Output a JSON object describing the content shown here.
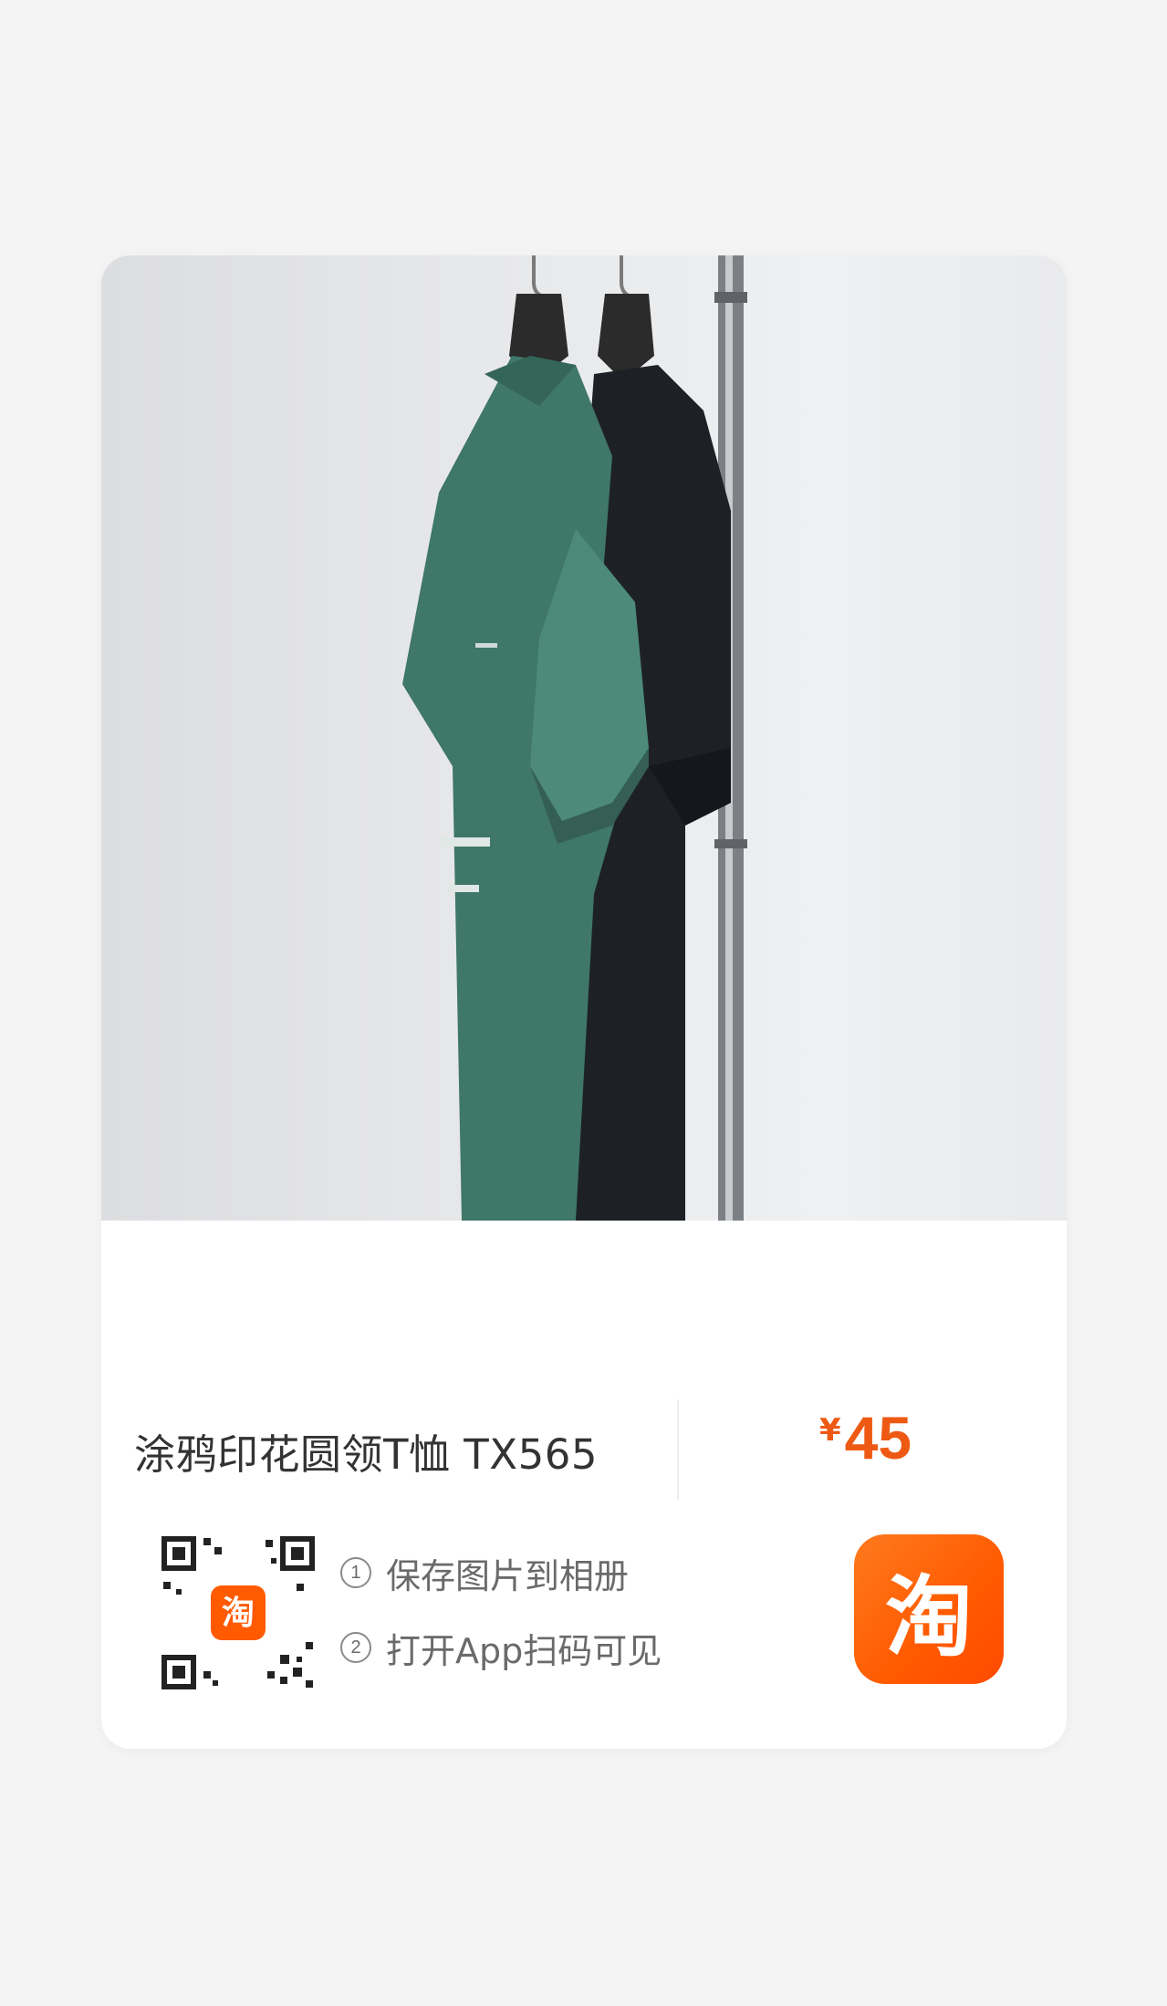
{
  "product": {
    "title": "涂鸦印花圆领T恤 TX565",
    "currency": "¥",
    "price": "45"
  },
  "qr_badge": "淘",
  "steps": [
    {
      "num": "1",
      "text": "保存图片到相册"
    },
    {
      "num": "2",
      "text": "打开App扫码可见"
    }
  ],
  "app_logo": {
    "glyph": "淘",
    "icon": "taobao-app-icon"
  },
  "colors": {
    "price": "#ee5a13",
    "logo": "#ff5a00",
    "shirt_green": "#3f7768",
    "shirt_black": "#1d2126"
  }
}
